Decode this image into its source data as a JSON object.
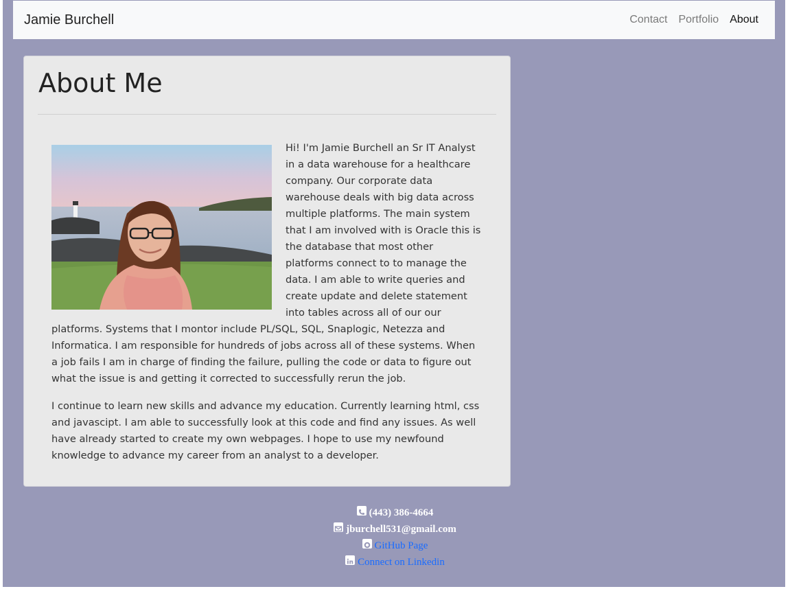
{
  "navbar": {
    "brand": "Jamie Burchell",
    "links": [
      {
        "label": "Contact"
      },
      {
        "label": "Portfolio"
      },
      {
        "label": "About"
      }
    ]
  },
  "about": {
    "title": "About Me",
    "paragraph1": "Hi! I'm Jamie Burchell an Sr IT Analyst in a data warehouse for a healthcare company. Our corporate data warehouse deals with big data across multiple platforms. The main system that I am involved with is Oracle this is the database that most other platforms connect to to manage the data. I am able to write queries and create update and delete statement into tables across all of our our platforms. Systems that I montor include PL/SQL, SQL, Snaplogic, Netezza and Informatica. I am responsible for hundreds of jobs across all of these systems. When a job fails I am in charge of finding the failure, pulling the code or data to figure out what the issue is and getting it corrected to successfully rerun the job.",
    "paragraph2": "I continue to learn new skills and advance my education. Currently learning html, css and javascipt. I am able to successfully look at this code and find any issues. As well have already started to create my own webpages. I hope to use my newfound knowledge to advance my career from an analyst to a developer."
  },
  "footer": {
    "phone": "(443) 386-4664",
    "email": "jburchell531@gmail.com",
    "github": "GitHub Page",
    "linkedin": "Connect on Linkedin"
  },
  "icons": {
    "phone": "phone-icon",
    "email": "envelope-icon",
    "github": "github-icon",
    "linkedin": "linkedin-icon"
  },
  "colors": {
    "page_background": "#9899b8",
    "card_background": "#e9e9e9",
    "navbar_background": "#f8f9fa",
    "link": "#1a6cff"
  }
}
